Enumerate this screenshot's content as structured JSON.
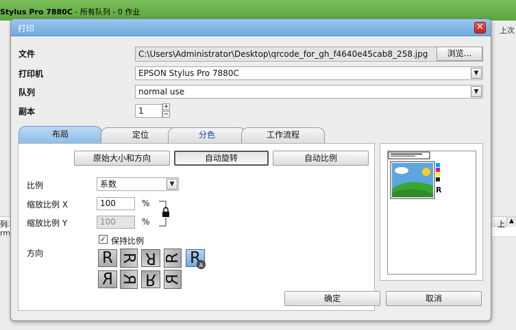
{
  "background": {
    "title_bold": "Stylus Pro 7880C",
    "title_rest": " - 所有队列 - 0 作业",
    "right_text": "上次",
    "strip_left_1": "列",
    "strip_left_2": "rma",
    "strip_right_1": "上",
    "accent": "#6cb34b"
  },
  "dialog": {
    "title": "打印",
    "close_symbol": "✕",
    "file": {
      "label": "文件",
      "value": "C:\\Users\\Administrator\\Desktop\\qrcode_for_gh_f4640e45cab8_258.jpg",
      "browse_label": "浏览..."
    },
    "printer": {
      "label": "打印机",
      "value": "EPSON Stylus Pro 7880C"
    },
    "queue": {
      "label": "队列",
      "value": "normal use"
    },
    "copies": {
      "label": "副本",
      "value": "1"
    },
    "tabs": [
      {
        "label": "布局",
        "active": true
      },
      {
        "label": "定位",
        "active": false
      },
      {
        "label": "分色",
        "active": false
      },
      {
        "label": "工作流程",
        "active": false
      }
    ],
    "layout": {
      "btn_original": "原始大小和方向",
      "btn_autorotate": "自动旋转",
      "btn_autoscale": "自动比例",
      "scale_label": "比例",
      "scale_value": "系数",
      "scale_x_label": "缩放比例 X",
      "scale_x_value": "100",
      "scale_y_label": "缩放比例 Y",
      "scale_y_value": "100",
      "percent": "%",
      "keep_ratio_label": "保持比例",
      "keep_ratio_checked": true,
      "orientation_label": "方向",
      "orientation_row1": [
        "R",
        "R",
        "R",
        "R",
        "R"
      ],
      "orientation_row2": [
        "R",
        "R",
        "R",
        "R"
      ],
      "auto_badge": "A"
    },
    "preview_mark": "R",
    "ok_label": "确定",
    "cancel_label": "取消"
  }
}
